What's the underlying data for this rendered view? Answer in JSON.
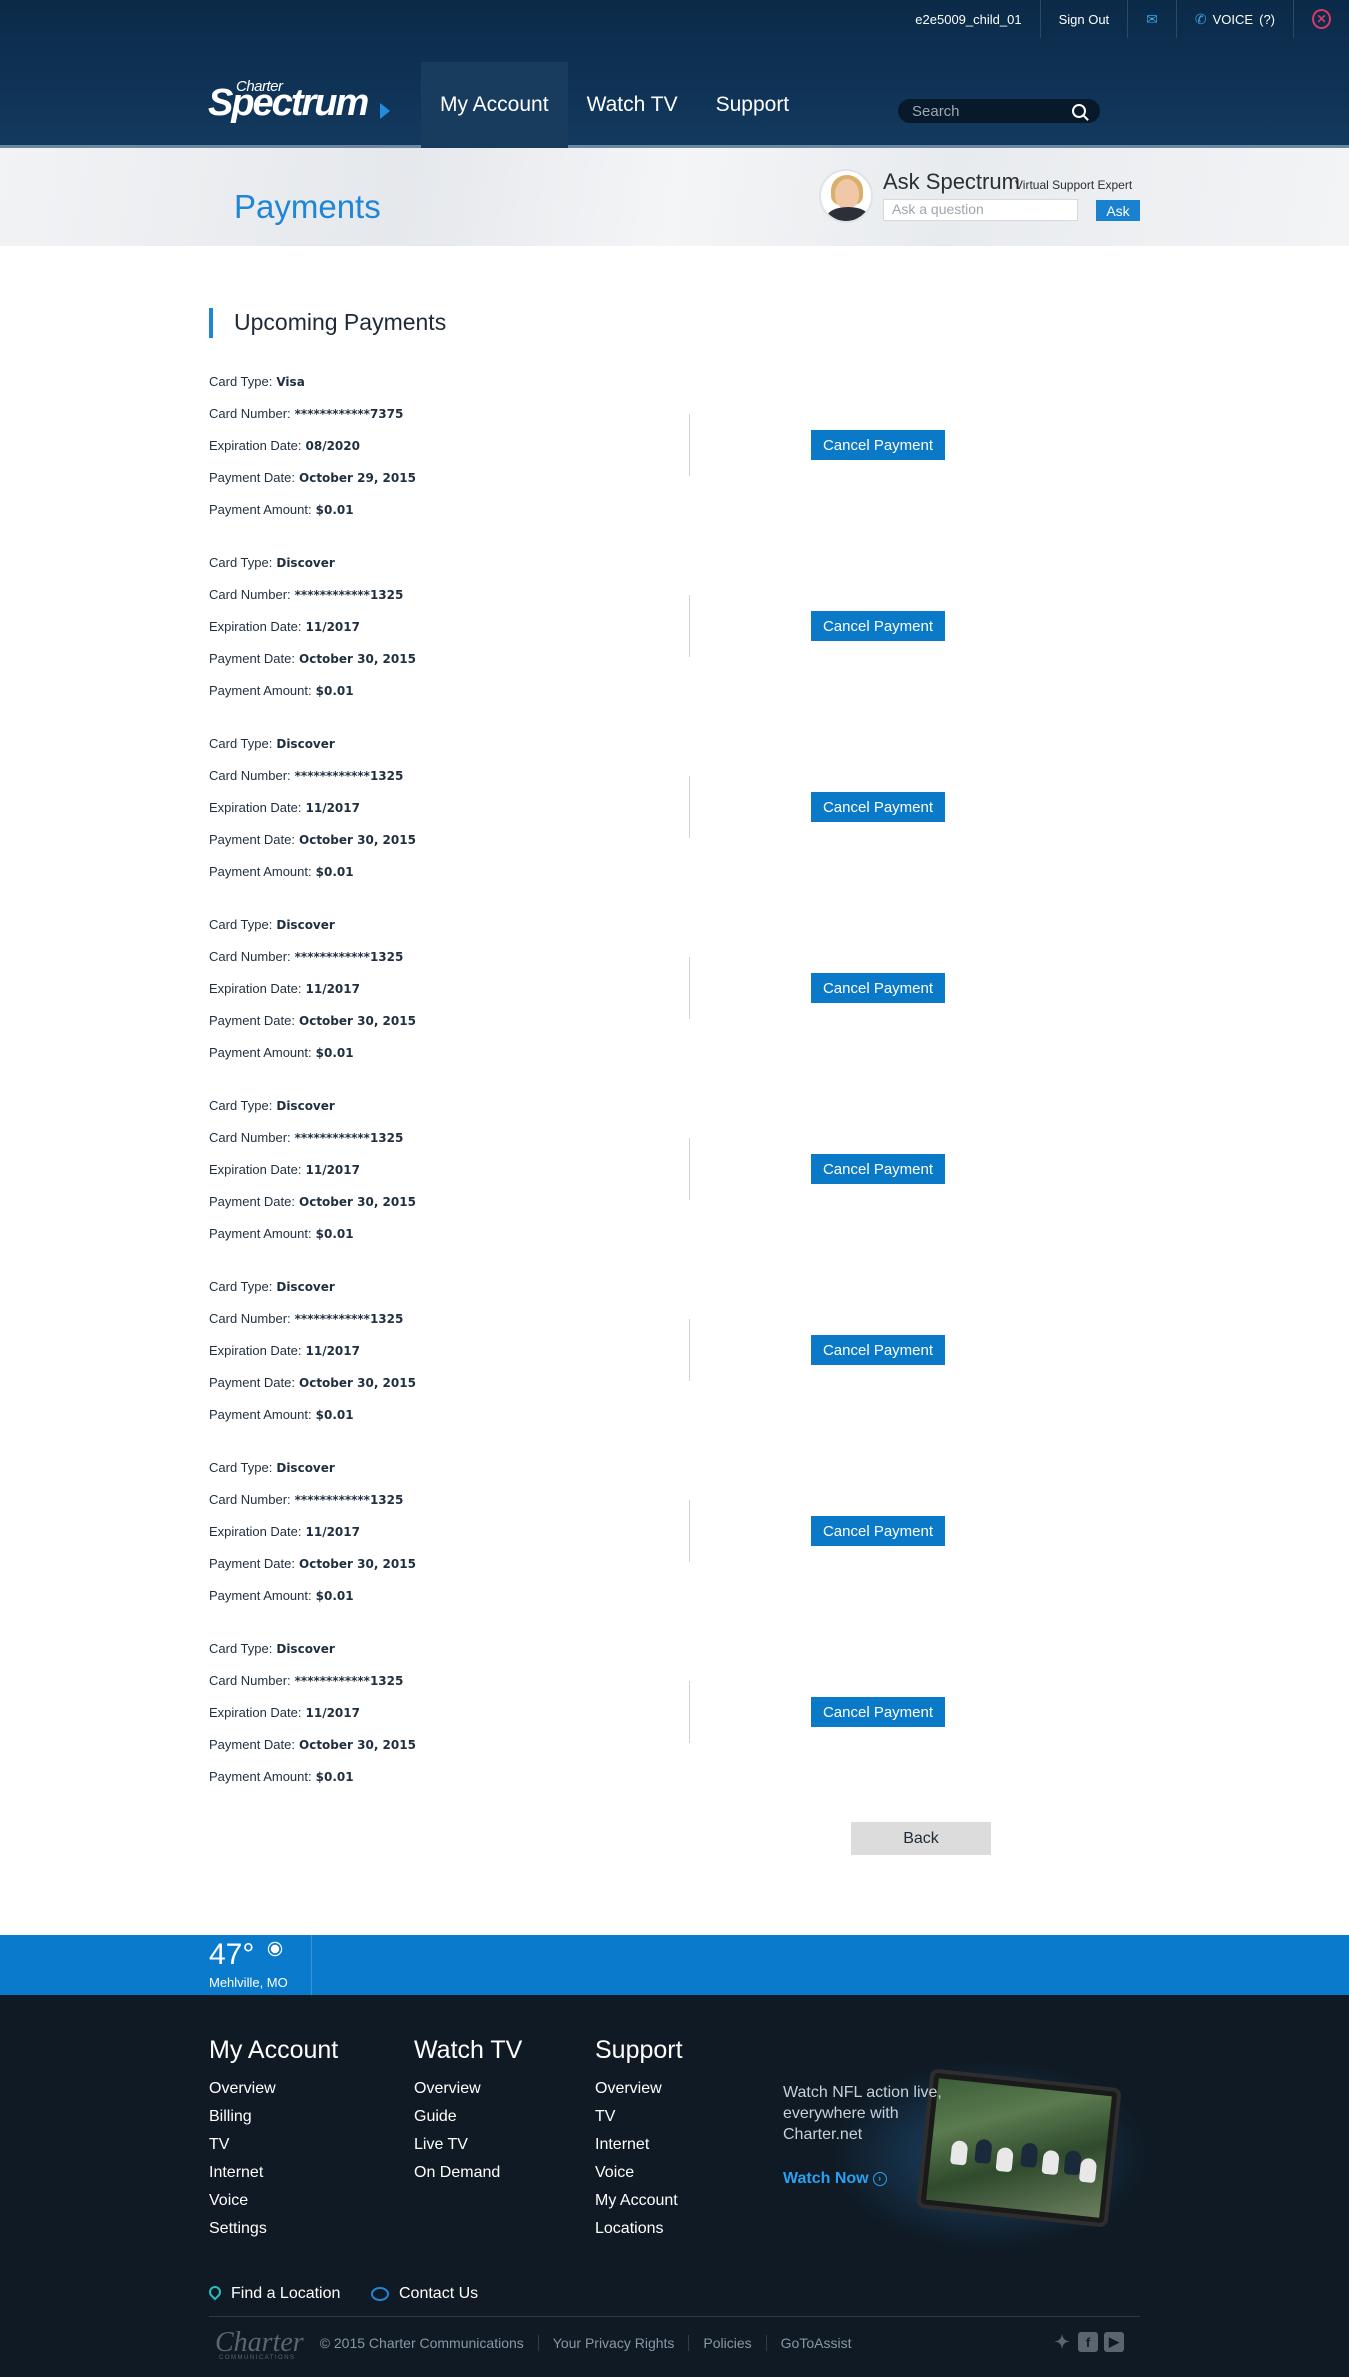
{
  "utility_bar": {
    "username": "e2e5009_child_01",
    "sign_out": "Sign Out",
    "voice_label": "VOICE",
    "voice_count": "(?)"
  },
  "logo": {
    "top": "Charter",
    "main": "Spectrum"
  },
  "nav": {
    "items": [
      {
        "label": "My Account",
        "active": true
      },
      {
        "label": "Watch TV",
        "active": false
      },
      {
        "label": "Support",
        "active": false
      }
    ]
  },
  "search": {
    "placeholder": "Search"
  },
  "banner": {
    "title": "Payments",
    "ask_title": "Ask Spectrum",
    "ask_subtitle": "Virtual Support Expert",
    "ask_placeholder": "Ask a question",
    "ask_button": "Ask"
  },
  "section": {
    "title": "Upcoming Payments"
  },
  "labels": {
    "card_type": "Card Type:",
    "card_number": "Card Number:",
    "expiration": "Expiration Date:",
    "payment_date": "Payment Date:",
    "payment_amount": "Payment Amount:",
    "cancel_button": "Cancel Payment"
  },
  "payments": [
    {
      "card_type": "Visa",
      "card_number": "************7375",
      "expiration": "08/2020",
      "payment_date": "October 29, 2015",
      "amount": "$0.01"
    },
    {
      "card_type": "Discover",
      "card_number": "************1325",
      "expiration": "11/2017",
      "payment_date": "October 30, 2015",
      "amount": "$0.01"
    },
    {
      "card_type": "Discover",
      "card_number": "************1325",
      "expiration": "11/2017",
      "payment_date": "October 30, 2015",
      "amount": "$0.01"
    },
    {
      "card_type": "Discover",
      "card_number": "************1325",
      "expiration": "11/2017",
      "payment_date": "October 30, 2015",
      "amount": "$0.01"
    },
    {
      "card_type": "Discover",
      "card_number": "************1325",
      "expiration": "11/2017",
      "payment_date": "October 30, 2015",
      "amount": "$0.01"
    },
    {
      "card_type": "Discover",
      "card_number": "************1325",
      "expiration": "11/2017",
      "payment_date": "October 30, 2015",
      "amount": "$0.01"
    },
    {
      "card_type": "Discover",
      "card_number": "************1325",
      "expiration": "11/2017",
      "payment_date": "October 30, 2015",
      "amount": "$0.01"
    },
    {
      "card_type": "Discover",
      "card_number": "************1325",
      "expiration": "11/2017",
      "payment_date": "October 30, 2015",
      "amount": "$0.01"
    }
  ],
  "back_button": "Back",
  "weather": {
    "temperature": "47°",
    "location": "Mehlville, MO"
  },
  "footer": {
    "columns": [
      {
        "title": "My Account",
        "links": [
          "Overview",
          "Billing",
          "TV",
          "Internet",
          "Voice",
          "Settings"
        ]
      },
      {
        "title": "Watch TV",
        "links": [
          "Overview",
          "Guide",
          "Live TV",
          "On Demand"
        ]
      },
      {
        "title": "Support",
        "links": [
          "Overview",
          "TV",
          "Internet",
          "Voice",
          "My Account",
          "Locations"
        ]
      }
    ],
    "promo_text": "Watch NFL action live, everywhere with Charter.net",
    "promo_link": "Watch Now",
    "find_location": "Find a Location",
    "contact_us": "Contact Us",
    "charter_logo": "Charter",
    "charter_logo_sub": "COMMUNICATIONS",
    "copyright": "© 2015 Charter Communications",
    "bottom_links": [
      "Your Privacy Rights",
      "Policies",
      "GoToAssist"
    ]
  },
  "colors": {
    "header_bg": "#0f3356",
    "accent_blue": "#1f86d6",
    "button_blue": "#0a79c8",
    "weather_bar": "#0a7bcc",
    "footer_bg": "#0f1a24"
  },
  "icons": {
    "mail": "mail-icon",
    "phone": "phone-icon",
    "close": "close-icon",
    "search": "search-icon",
    "sun": "sun-icon",
    "pin": "map-pin-icon",
    "chat": "chat-bubble-icon"
  }
}
